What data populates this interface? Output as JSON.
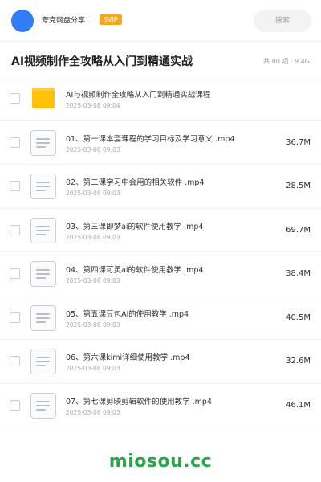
{
  "header": {
    "username": "夸克网盘分享",
    "badge": "SVIP",
    "search_label": "搜索"
  },
  "title": {
    "text": "AI视频制作全攻略从入门到精通实战",
    "summary": "共 80 项 · 9.4G"
  },
  "items": [
    {
      "type": "folder",
      "name": "AI与视频制作全攻略从入门到精通实战课程",
      "date": "2025-03-08 09:04",
      "size": ""
    },
    {
      "type": "file",
      "name": "01、第一课本套课程的学习目标及学习意义 .mp4",
      "date": "2025-03-08 09:03",
      "size": "36.7M"
    },
    {
      "type": "file",
      "name": "02、第二课学习中会用的相关软件 .mp4",
      "date": "2025-03-08 09:03",
      "size": "28.5M"
    },
    {
      "type": "file",
      "name": "03、第三课即梦ai的软件使用教学 .mp4",
      "date": "2025-03-08 09:03",
      "size": "69.7M"
    },
    {
      "type": "file",
      "name": "04、第四课可灵ai的软件使用教学 .mp4",
      "date": "2025-03-08 09:03",
      "size": "38.4M"
    },
    {
      "type": "file",
      "name": "05、第五课豆包Ai的使用教学 .mp4",
      "date": "2025-03-08 09:03",
      "size": "40.5M"
    },
    {
      "type": "file",
      "name": "06、第六课kimi详细使用教学 .mp4",
      "date": "2025-03-08 09:03",
      "size": "32.6M"
    },
    {
      "type": "file",
      "name": "07、第七课剪映剪辑软件的使用教学 .mp4",
      "date": "2025-03-08 09:03",
      "size": "46.1M"
    }
  ],
  "watermark": "miosou.cc",
  "colors": {
    "avatar": "#2f7cf6",
    "svip": "#f5a623",
    "folder": "#ffc107",
    "watermark": "#2aa54a"
  }
}
